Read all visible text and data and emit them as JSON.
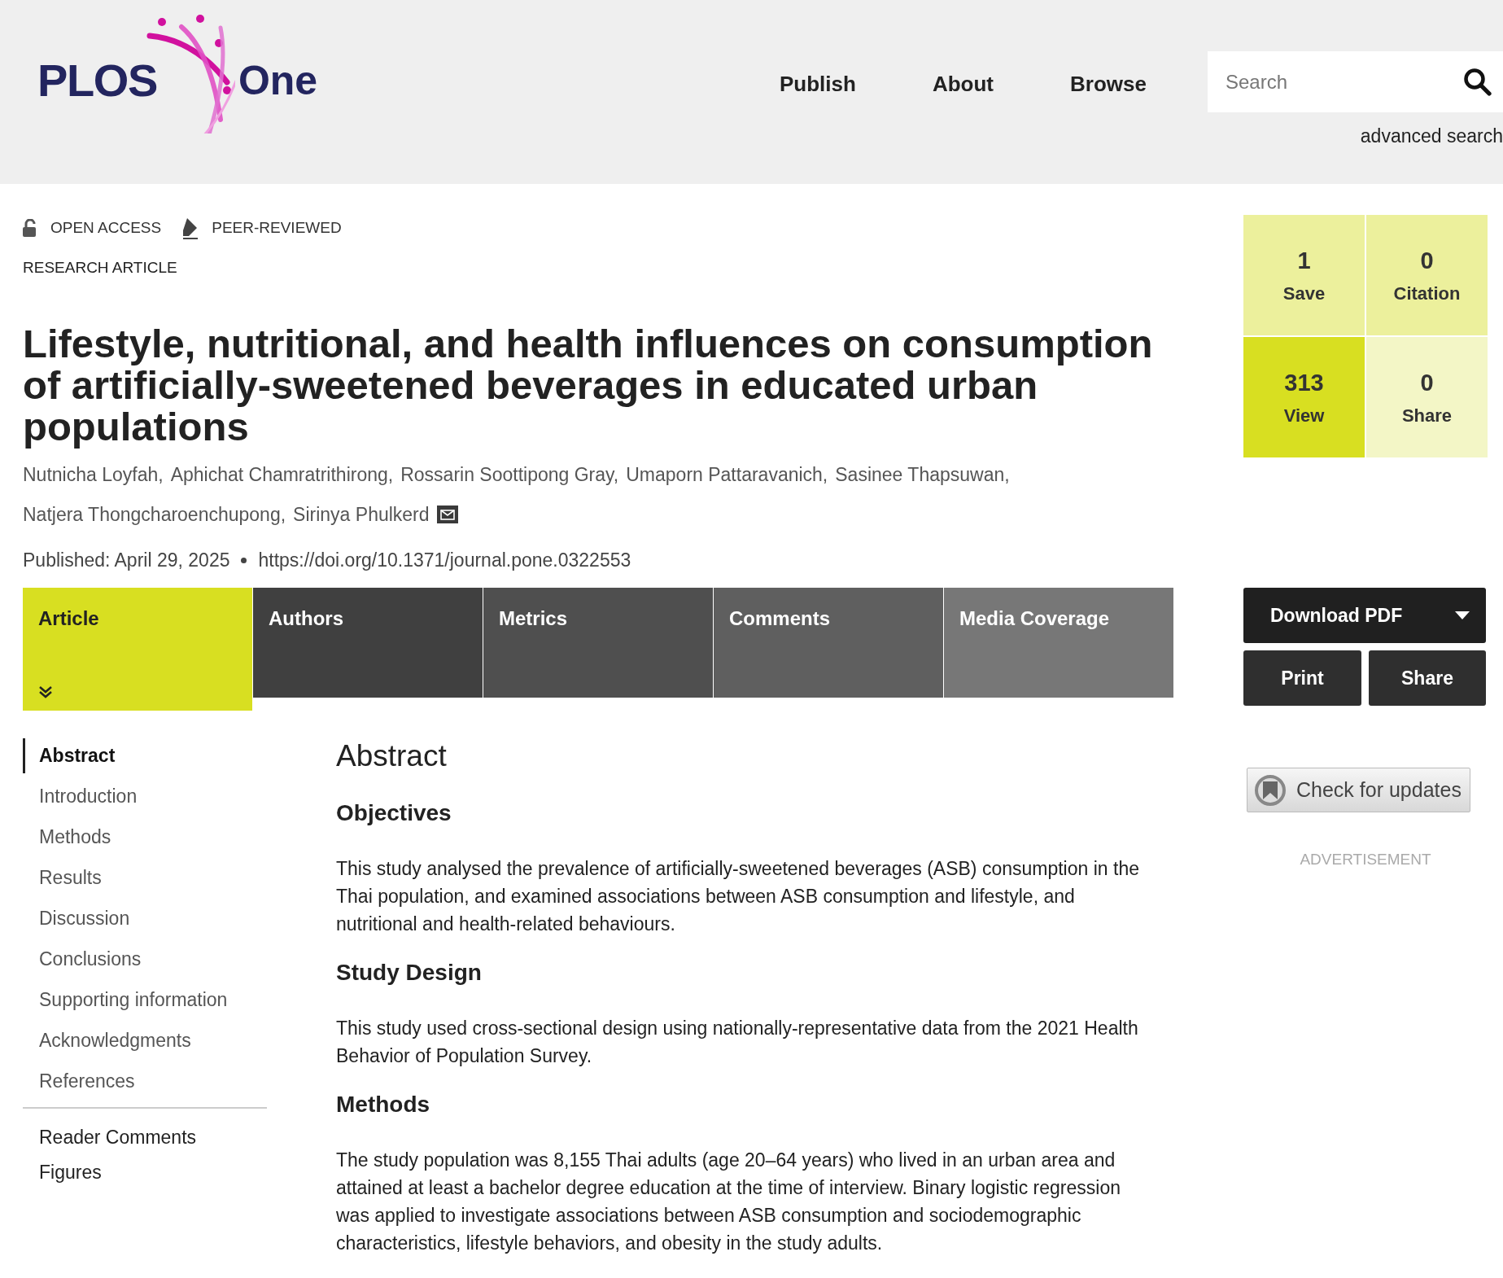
{
  "header": {
    "logo": {
      "name": "PLOS",
      "product": "One"
    },
    "nav": [
      "Publish",
      "About",
      "Browse"
    ],
    "search": {
      "placeholder": "Search"
    },
    "advanced_search": "advanced search"
  },
  "badges": [
    "OPEN ACCESS",
    "PEER-REVIEWED"
  ],
  "article_type": "RESEARCH ARTICLE",
  "title": "Lifestyle, nutritional, and health influences on consumption of artificially-sweetened beverages in educated urban populations",
  "authors": [
    "Nutnicha Loyfah,",
    "Aphichat Chamratrithirong,",
    "Rossarin Soottipong Gray,",
    "Umaporn Pattaravanich,",
    "Sasinee Thapsuwan,",
    "Natjera Thongcharoenchupong,",
    "Sirinya Phulkerd"
  ],
  "published": "Published: April 29, 2025",
  "doi": "https://doi.org/10.1371/journal.pone.0322553",
  "tabs": [
    {
      "label": "Article",
      "selected": true,
      "color": "#d8df21"
    },
    {
      "label": "Authors",
      "selected": false,
      "color": "#404040"
    },
    {
      "label": "Metrics",
      "selected": false,
      "color": "#4f4f4f"
    },
    {
      "label": "Comments",
      "selected": false,
      "color": "#5f5f5f"
    },
    {
      "label": "Media Coverage",
      "selected": false,
      "color": "#777777"
    }
  ],
  "outline": [
    {
      "label": "Abstract",
      "selected": true
    },
    {
      "label": "Introduction",
      "selected": false
    },
    {
      "label": "Methods",
      "selected": false
    },
    {
      "label": "Results",
      "selected": false
    },
    {
      "label": "Discussion",
      "selected": false
    },
    {
      "label": "Conclusions",
      "selected": false
    },
    {
      "label": "Supporting information",
      "selected": false
    },
    {
      "label": "Acknowledgments",
      "selected": false
    },
    {
      "label": "References",
      "selected": false
    }
  ],
  "outline_extra": [
    "Reader Comments",
    "Figures"
  ],
  "abstract": {
    "heading": "Abstract",
    "sections": [
      {
        "heading": "Objectives",
        "text": "This study analysed the prevalence of artificially-sweetened beverages (ASB) consumption in the Thai population, and examined associations between ASB consumption and lifestyle, and nutritional and health-related behaviours."
      },
      {
        "heading": "Study Design",
        "text": "This study used cross-sectional design using nationally-representative data from the 2021 Health Behavior of Population Survey."
      },
      {
        "heading": "Methods",
        "text": "The study population was 8,155 Thai adults (age 20–64 years) who lived in an urban area and attained at least a bachelor degree education at the time of interview. Binary logistic regression was applied to investigate associations between ASB consumption and sociodemographic characteristics, lifestyle behaviors, and obesity in the study adults."
      }
    ]
  },
  "metrics": [
    {
      "value": "1",
      "label": "Save",
      "color": "#ecf09c"
    },
    {
      "value": "0",
      "label": "Citation",
      "color": "#ecf09c"
    },
    {
      "value": "313",
      "label": "View",
      "color": "#d8df21"
    },
    {
      "value": "0",
      "label": "Share",
      "color": "#f3f6c6"
    }
  ],
  "actions": {
    "download": "Download PDF",
    "print": "Print",
    "share": "Share"
  },
  "check_updates": "Check for updates",
  "advertisement": "ADVERTISEMENT"
}
